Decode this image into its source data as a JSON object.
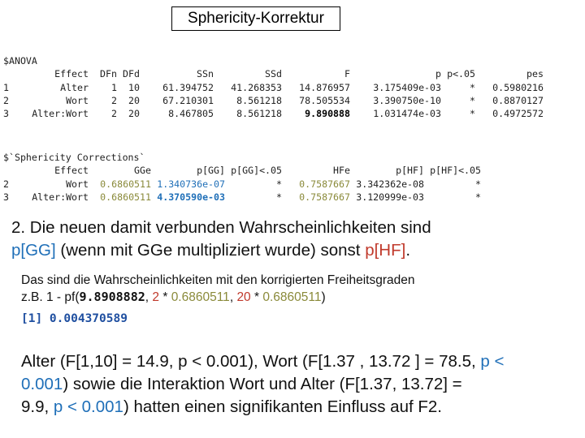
{
  "title": "Sphericity-Korrektur",
  "anova": {
    "label": "$ANOVA",
    "headers": [
      "",
      "Effect",
      "DFn",
      "DFd",
      "SSn",
      "SSd",
      "F",
      "p",
      "p<.05",
      "pes"
    ],
    "rows": [
      [
        "1",
        "Alter",
        "1",
        "10",
        "61.394752",
        "41.268353",
        "14.876957",
        "3.175409e-03",
        "*",
        "0.5980216"
      ],
      [
        "2",
        "Wort",
        "2",
        "20",
        "67.210301",
        "8.561218",
        "78.505534",
        "3.390750e-10",
        "*",
        "0.8870127"
      ],
      [
        "3",
        "Alter:Wort",
        "2",
        "20",
        "8.467805",
        "8.561218",
        "9.890888",
        "1.031474e-03",
        "*",
        "0.4972572"
      ]
    ]
  },
  "sphericity": {
    "label": "$`Sphericity Corrections`",
    "headers": [
      "",
      "Effect",
      "GGe",
      "p[GG]",
      "p[GG]<.05",
      "HFe",
      "p[HF]",
      "p[HF]<.05"
    ],
    "rows": [
      [
        "2",
        "Wort",
        "0.6860511",
        "1.340736e-07",
        "*",
        "0.7587667",
        "3.342362e-08",
        "*"
      ],
      [
        "3",
        "Alter:Wort",
        "0.6860511",
        "4.370590e-03",
        "*",
        "0.7587667",
        "3.120999e-03",
        "*"
      ]
    ]
  },
  "para1": {
    "line1": "2. Die neuen damit verbunden Wahrscheinlichkeiten sind",
    "pgg": "p[GG]",
    "mid": " (wenn mit GGe multipliziert wurde) sonst ",
    "phf": "p[HF]",
    "end": "."
  },
  "para2": {
    "line1": "Das sind die Wahrscheinlichkeiten mit den korrigierten Freiheitsgraden",
    "prefix": "z.B. 1 - pf(",
    "f": "9.8908882",
    "sep1": ", ",
    "df1": "2",
    "star1": " * ",
    "gge1": "0.6860511",
    "sep2": ", ",
    "df2": "20",
    "star2": " * ",
    "gge2": "0.6860511",
    "suffix": ")"
  },
  "r_output": "[1] 0.004370589",
  "para3": {
    "t1": "Alter (F[1,10] = 14.9, p < 0.001), Wort (F[1.37 , 13.72 ] = 78.5, ",
    "p1": "p <",
    "t2": "0.001",
    "t3": ") sowie die Interaktion Wort  und Alter (F[1.37, 13.72] =",
    "t4": "9.9, ",
    "p2": "p < 0.001",
    "t5": ") hatten einen signifikanten Einfluss auf F2."
  }
}
